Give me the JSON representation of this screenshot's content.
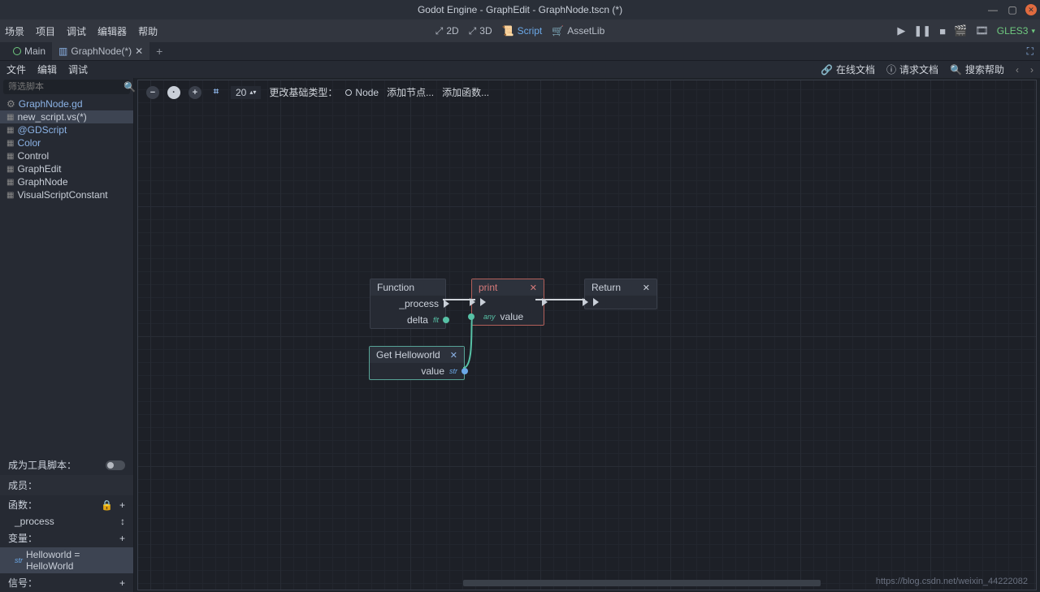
{
  "window": {
    "title": "Godot Engine - GraphEdit - GraphNode.tscn (*)"
  },
  "menu": {
    "items": [
      "场景",
      "项目",
      "调试",
      "编辑器",
      "帮助"
    ],
    "modes": {
      "m2d": "2D",
      "m3d": "3D",
      "script": "Script",
      "assetlib": "AssetLib"
    },
    "gles": "GLES3"
  },
  "tabs": {
    "main": "Main",
    "graphnode": "GraphNode(*)"
  },
  "submenu": {
    "items": [
      "文件",
      "编辑",
      "调试"
    ],
    "right": {
      "online": "在线文档",
      "request": "请求文档",
      "search": "搜索帮助"
    }
  },
  "sidebar": {
    "filter_placeholder": "筛选脚本",
    "scripts": [
      {
        "name": "GraphNode.gd",
        "icon": "gear",
        "cls": ""
      },
      {
        "name": "new_script.vs(*)",
        "icon": "grid",
        "cls": "selected mod"
      },
      {
        "name": "@GDScript",
        "icon": "grid",
        "cls": ""
      },
      {
        "name": "Color",
        "icon": "grid",
        "cls": ""
      },
      {
        "name": "Control",
        "icon": "grid",
        "cls": "mod"
      },
      {
        "name": "GraphEdit",
        "icon": "grid",
        "cls": "mod"
      },
      {
        "name": "GraphNode",
        "icon": "grid",
        "cls": "mod"
      },
      {
        "name": "VisualScriptConstant",
        "icon": "grid",
        "cls": "mod"
      }
    ],
    "tool_script": "成为工具脚本：",
    "members": "成员：",
    "functions": "函数：",
    "func_item": "_process",
    "variables": "变量：",
    "var_item": "Helloworld = HelloWorld",
    "signals": "信号："
  },
  "canvas": {
    "zoom": "20",
    "change_base": "更改基础类型：",
    "node_label": "Node",
    "add_node": "添加节点...",
    "add_func": "添加函数..."
  },
  "nodes": {
    "function": {
      "title": "Function",
      "process": "_process",
      "delta": "delta",
      "delta_tag": "flt"
    },
    "print": {
      "title": "print",
      "value": "value",
      "value_tag": "any"
    },
    "ret": {
      "title": "Return"
    },
    "get": {
      "title": "Get Helloworld",
      "value": "value",
      "value_tag": "str"
    }
  },
  "watermark": "https://blog.csdn.net/weixin_44222082"
}
